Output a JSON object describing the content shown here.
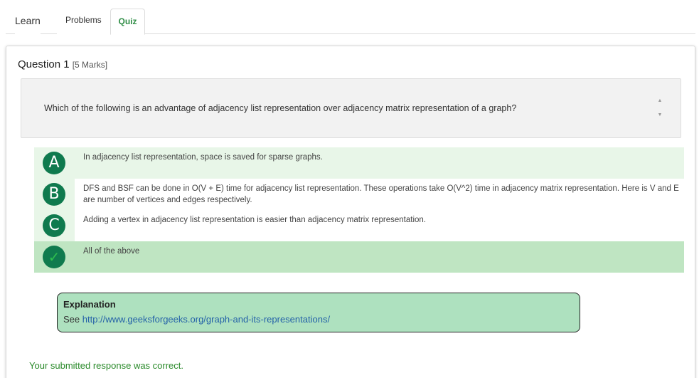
{
  "tabs": [
    {
      "label": "Learn"
    },
    {
      "label": "Problems"
    },
    {
      "label": "Quiz",
      "active": true
    }
  ],
  "question": {
    "title": "Question 1",
    "marks": "[5 Marks]",
    "text": "Which of the following is an advantage of adjacency list representation over adjacency matrix representation of a graph?"
  },
  "options": [
    {
      "badge": "A",
      "text": "In adjacency list representation, space is saved for sparse graphs."
    },
    {
      "badge": "B",
      "text": "DFS and BSF can be done in O(V + E) time for adjacency list representation. These operations take O(V^2) time in adjacency matrix representation. Here is V and E are number of vertices and edges respectively."
    },
    {
      "badge": "C",
      "text": "Adding a vertex in adjacency list representation is easier than adjacency matrix representation."
    },
    {
      "badge": "✓",
      "text": "All of the above",
      "correct": true
    }
  ],
  "explanation": {
    "title": "Explanation",
    "prefix": "See",
    "link": "http://www.geeksforgeeks.org/graph-and-its-representations/"
  },
  "result": "Your submitted response was correct.",
  "colors": {
    "accent": "#2f8d46",
    "badge": "#0f7a4e",
    "correct_bg": "#bfe5c2",
    "option_bg": "#e8f6e8",
    "explanation_bg": "#aee1bf",
    "link": "#2462a8",
    "result_text": "#2a8a2a"
  }
}
